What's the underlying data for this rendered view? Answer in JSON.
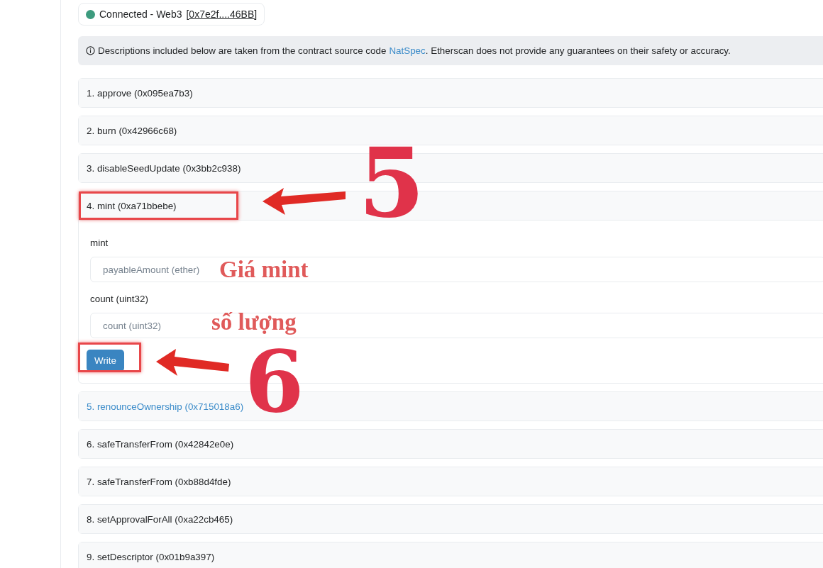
{
  "connection": {
    "status": "Connected - Web3",
    "address": "[0x7e2f....46BB]",
    "color": "#3d9b7e"
  },
  "notice": {
    "text_before": "Descriptions included below are taken from the contract source code",
    "link": "NatSpec",
    "text_after": ". Etherscan does not provide any guarantees on their safety or accuracy."
  },
  "functions": [
    {
      "label": "1. approve (0x095ea7b3)",
      "expanded": false,
      "highlighted": false,
      "framed": false
    },
    {
      "label": "2. burn (0x42966c68)",
      "expanded": false,
      "highlighted": false,
      "framed": false
    },
    {
      "label": "3. disableSeedUpdate (0x3bb2c938)",
      "expanded": false,
      "highlighted": false,
      "framed": false
    },
    {
      "label": "4. mint (0xa71bbebe)",
      "expanded": true,
      "highlighted": false,
      "framed": true,
      "inputs": [
        {
          "label": "mint",
          "placeholder": "payableAmount (ether)",
          "note": "Giá mint"
        },
        {
          "label": "count (uint32)",
          "placeholder": "count (uint32)",
          "note": "số lượng"
        }
      ],
      "button": "Write"
    },
    {
      "label": "5. renounceOwnership (0x715018a6)",
      "expanded": false,
      "highlighted": true,
      "framed": false
    },
    {
      "label": "6. safeTransferFrom (0x42842e0e)",
      "expanded": false,
      "highlighted": false,
      "framed": false
    },
    {
      "label": "7. safeTransferFrom (0xb88d4fde)",
      "expanded": false,
      "highlighted": false,
      "framed": false
    },
    {
      "label": "8. setApprovalForAll (0xa22cb465)",
      "expanded": false,
      "highlighted": false,
      "framed": false
    },
    {
      "label": "9. setDescriptor (0x01b9a397)",
      "expanded": false,
      "highlighted": false,
      "framed": false
    }
  ],
  "annotations": {
    "numbers": [
      "5",
      "6"
    ]
  }
}
